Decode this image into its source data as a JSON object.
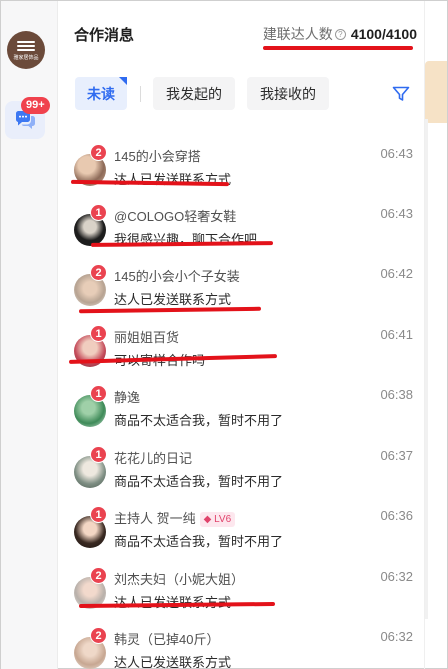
{
  "rail": {
    "logo_text": "雅家居饰品",
    "unread_badge": "99+"
  },
  "header": {
    "title": "合作消息",
    "quota_label": "建联达人数",
    "info_glyph": "?",
    "quota_value": "4100/4100"
  },
  "tabs": [
    {
      "label": "未读",
      "active": true
    },
    {
      "label": "我发起的",
      "active": false
    },
    {
      "label": "我接收的",
      "active": false
    }
  ],
  "conversations": [
    {
      "name": "145的小会穿搭",
      "time": "06:43",
      "message": "达人已发送联系方式",
      "badge": "2"
    },
    {
      "name": "@COLOGO轻奢女鞋",
      "time": "06:43",
      "message": "我很感兴趣，聊下合作吧",
      "badge": "1"
    },
    {
      "name": "145的小会小个子女装",
      "time": "06:42",
      "message": "达人已发送联系方式",
      "badge": "2"
    },
    {
      "name": "丽姐姐百货",
      "time": "06:41",
      "message": "可以寄样合作吗",
      "badge": "1"
    },
    {
      "name": "静逸",
      "time": "06:38",
      "message": "商品不太适合我，暂时不用了",
      "badge": "1"
    },
    {
      "name": "花花儿的日记",
      "time": "06:37",
      "message": "商品不太适合我，暂时不用了",
      "badge": "1"
    },
    {
      "name": "主持人 贺一纯",
      "level": "LV6",
      "time": "06:36",
      "message": "商品不太适合我，暂时不用了",
      "badge": "1"
    },
    {
      "name": "刘杰夫妇（小妮大姐）",
      "time": "06:32",
      "message": "达人已发送联系方式",
      "badge": "2"
    },
    {
      "name": "韩灵（已掉40斤）",
      "time": "06:32",
      "message": "达人已发送联系方式",
      "badge": "2"
    }
  ],
  "colors": {
    "accent": "#2f6bf0",
    "badge": "#ea4350",
    "annotation": "#e3121a"
  }
}
